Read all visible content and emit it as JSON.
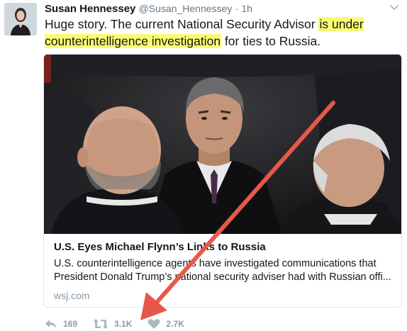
{
  "tweet": {
    "author": {
      "display_name": "Susan Hennessey",
      "handle": "@Susan_Hennessey",
      "separator": "·",
      "time": "1h"
    },
    "text": {
      "part1": "Huge story. The current National Security Advisor ",
      "highlight": "is under counterintelligence investigation",
      "part2": " for ties to Russia."
    },
    "card": {
      "title": "U.S. Eyes Michael Flynn’s Links to Russia",
      "description": "U.S. counterintelligence agents have investigated communications that President Donald Trump’s national security adviser had with Russian offi...",
      "domain": "wsj.com"
    },
    "actions": {
      "reply_count": "169",
      "retweet_count": "3.1K",
      "like_count": "2.7K"
    },
    "icons": {
      "caret": "chevron-down-icon",
      "reply": "reply-icon",
      "retweet": "retweet-icon",
      "like": "heart-icon"
    },
    "colors": {
      "highlight": "#fbfb72",
      "annotation_arrow": "#e8584a",
      "muted": "#8899a6"
    }
  }
}
